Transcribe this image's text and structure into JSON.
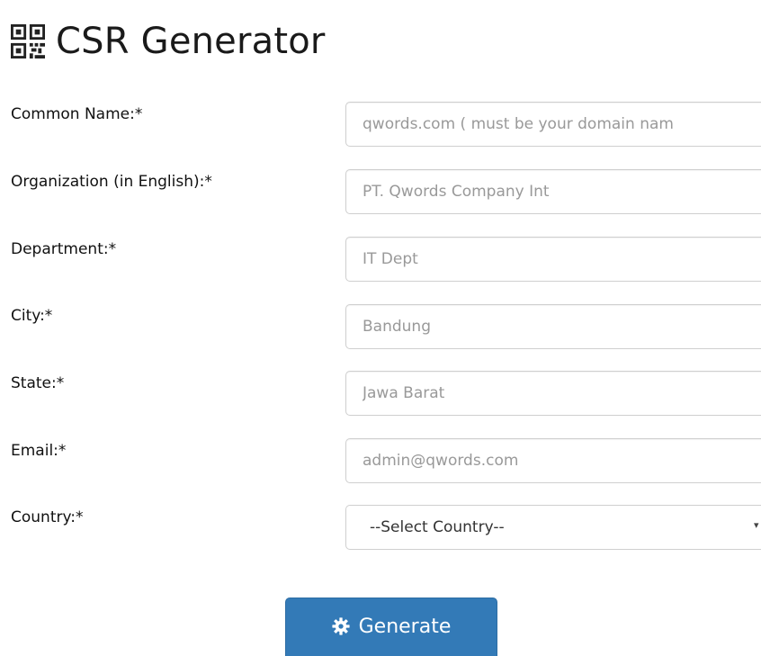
{
  "header": {
    "title": "CSR Generator",
    "icon": "qrcode-icon"
  },
  "form": {
    "fields": [
      {
        "label": "Common Name:*",
        "placeholder": "qwords.com ( must be your domain nam",
        "value": ""
      },
      {
        "label": "Organization (in English):*",
        "placeholder": "PT. Qwords Company Int",
        "value": ""
      },
      {
        "label": "Department:*",
        "placeholder": "IT Dept",
        "value": ""
      },
      {
        "label": "City:*",
        "placeholder": "Bandung",
        "value": ""
      },
      {
        "label": "State:*",
        "placeholder": "Jawa Barat",
        "value": ""
      },
      {
        "label": "Email:*",
        "placeholder": "admin@qwords.com",
        "value": ""
      }
    ],
    "country": {
      "label": "Country:*",
      "selected": "--Select Country--",
      "arrow_glyph": "▾"
    }
  },
  "actions": {
    "generate_label": "Generate",
    "generate_icon": "gear-icon",
    "button_color": "#337ab7"
  }
}
